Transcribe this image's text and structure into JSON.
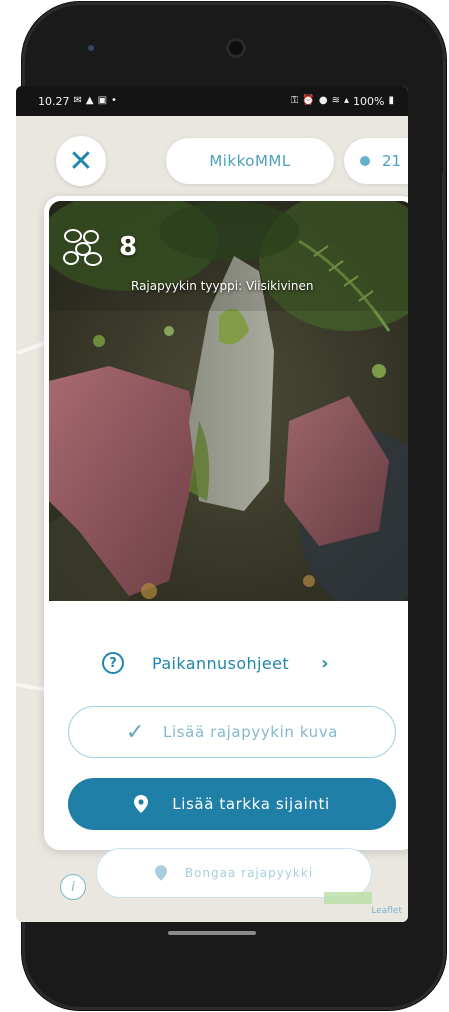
{
  "status_bar": {
    "time": "10.27",
    "battery": "100%"
  },
  "header": {
    "username": "MikkoMML",
    "points": "21"
  },
  "photo_card": {
    "stone_count": "8",
    "boundary_type": "Rajapyykin tyyppi: Viisikivinen"
  },
  "actions": {
    "guide_label": "Paikannusohjeet",
    "add_photo_label": "Lisää rajapyykin kuva",
    "add_location_label": "Lisää tarkka sijainti"
  },
  "map_overlay": {
    "spot_label": "Bongaa rajapyykki",
    "attribution": "Leaflet"
  },
  "colors": {
    "accent": "#1f7fa6",
    "accent_light": "#9fd0e0"
  },
  "icons": {
    "close": "close-icon",
    "points": "dot-icon",
    "stones": "stones-icon",
    "help": "question-circle-icon",
    "chevron": "chevron-right-icon",
    "check": "check-icon",
    "pin": "location-pin-icon",
    "info": "info-icon"
  }
}
